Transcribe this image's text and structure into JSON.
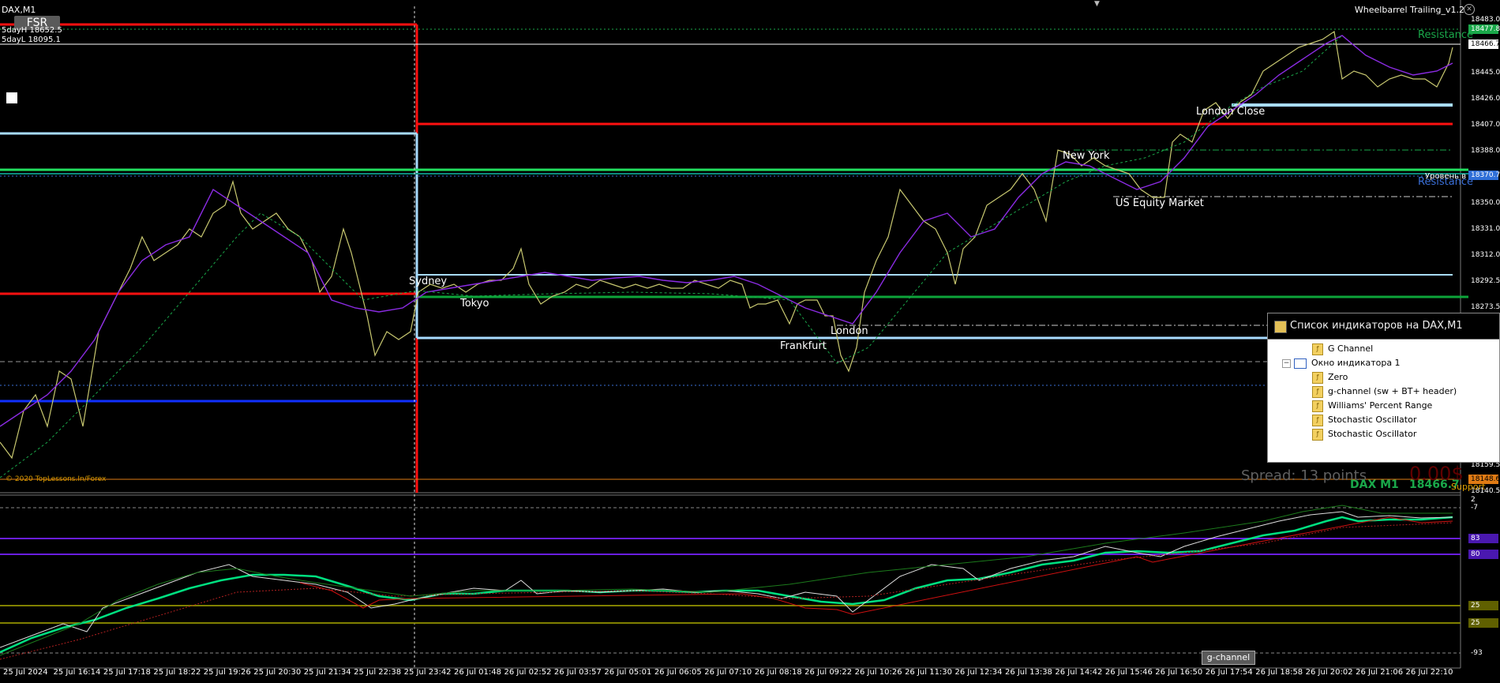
{
  "window": {
    "symbol_title": "DAX,M1",
    "fsr_button": "FSR",
    "five_day_high": "5dayH 18652.5",
    "five_day_low": "5dayL 18095.1",
    "expert_label": "Wheelbarrel Trailing_v1.2",
    "close_glyph": "✕"
  },
  "price_axis": {
    "ticks": [
      "18483.0",
      "18445.0",
      "18426.0",
      "18407.0",
      "18388.0",
      "18350.0",
      "18331.0",
      "18312.0",
      "18292.5",
      "18273.5",
      "18159.5",
      "18140.5"
    ],
    "tags": {
      "resistance_top": "18477.8",
      "current": "18466.7",
      "level_blue": "18370.7",
      "support": "18148.6"
    }
  },
  "sub_axis": {
    "ticks": [
      "2",
      "-7",
      "-93"
    ],
    "tags": [
      "83",
      "80",
      "25",
      "25"
    ]
  },
  "session_labels": {
    "sydney": "Sydney",
    "tokyo": "Tokyo",
    "frankfurt": "Frankfurt",
    "london": "London",
    "new_york": "New York",
    "us_equity": "US Equity Market",
    "london_close": "London Close"
  },
  "level_labels": {
    "resistance_top": "Resistance",
    "resistance_mid": "Resistance",
    "level_ru": "Уровень в",
    "support": "Support"
  },
  "info": {
    "spread": "Spread: 13 points",
    "profit": "0.00$",
    "symbol_tf": "DAX M1",
    "price": "18466.7",
    "copyright": "© 2020 TopLessons.In/Forex"
  },
  "subwindow": {
    "indicator_tag": "g-channel"
  },
  "x_axis": {
    "labels": [
      "25 Jul 2024",
      "25 Jul 16:14",
      "25 Jul 17:18",
      "25 Jul 18:22",
      "25 Jul 19:26",
      "25 Jul 20:30",
      "25 Jul 21:34",
      "25 Jul 22:38",
      "25 Jul 23:42",
      "26 Jul 01:48",
      "26 Jul 02:52",
      "26 Jul 03:57",
      "26 Jul 05:01",
      "26 Jul 06:05",
      "26 Jul 07:10",
      "26 Jul 08:18",
      "26 Jul 09:22",
      "26 Jul 10:26",
      "26 Jul 11:30",
      "26 Jul 12:34",
      "26 Jul 13:38",
      "26 Jul 14:42",
      "26 Jul 15:46",
      "26 Jul 16:50",
      "26 Jul 17:54",
      "26 Jul 18:58",
      "26 Jul 20:02",
      "26 Jul 21:06",
      "26 Jul 22:10"
    ]
  },
  "indicator_popup": {
    "title": "Список индикаторов на DAX,M1",
    "items": [
      {
        "label": "G Channel",
        "icon": "indicator-icon"
      },
      {
        "label": "Окно индикатора 1",
        "icon": "window-icon"
      },
      {
        "label": "Zero",
        "icon": "indicator-icon"
      },
      {
        "label": "g-channel (sw + BT+ header)",
        "icon": "indicator-icon"
      },
      {
        "label": "Williams' Percent Range",
        "icon": "indicator-icon"
      },
      {
        "label": "Stochastic Oscillator",
        "icon": "indicator-icon"
      },
      {
        "label": "Stochastic Oscillator",
        "icon": "indicator-icon"
      }
    ]
  },
  "colors": {
    "resistance": "#1aa84a",
    "red_level": "#ff1010",
    "light_blue_level": "#a8dcff",
    "green_level": "#22e060",
    "dark_blue_level": "#1030ff",
    "purple_ma": "#8a2be2",
    "support": "#e0a000"
  }
}
